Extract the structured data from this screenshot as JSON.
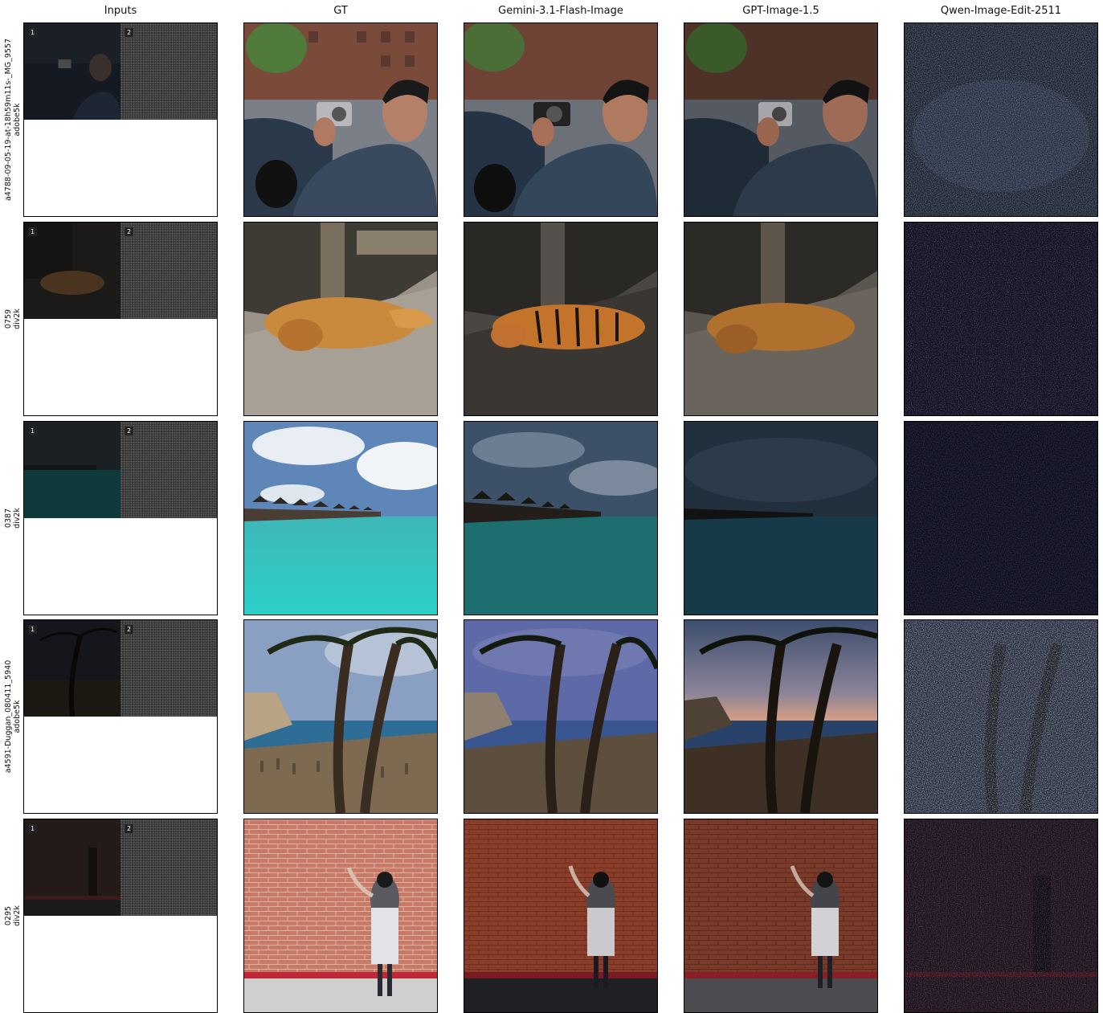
{
  "columns": [
    "Inputs",
    "GT",
    "Gemini-3.1-Flash-Image",
    "GPT-Image-1.5",
    "Qwen-Image-Edit-2511"
  ],
  "rows": [
    {
      "id": "a4788-09-05-19-at-18h59m11s-_MG_9557",
      "dataset": "adobe5k"
    },
    {
      "id": "0759",
      "dataset": "div2k"
    },
    {
      "id": "0387",
      "dataset": "div2k"
    },
    {
      "id": "a4591-Duggan_080411_5940",
      "dataset": "adobe5k"
    },
    {
      "id": "0295",
      "dataset": "div2k"
    }
  ],
  "input_badges": [
    "1",
    "2"
  ],
  "scenes": [
    "man-with-camera",
    "dog-lying",
    "ocean-villas",
    "palm-beach",
    "woman-brick-wall"
  ]
}
